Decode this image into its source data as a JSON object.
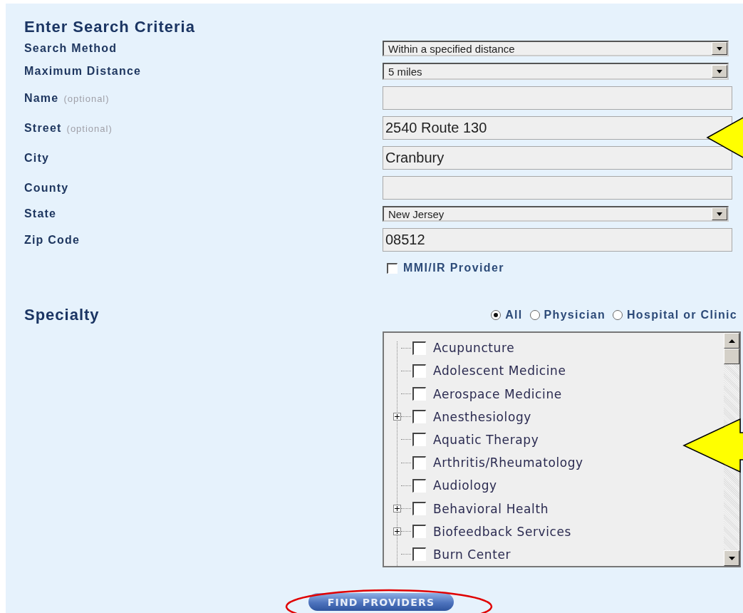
{
  "heading": "Enter Search Criteria",
  "fields": [
    {
      "kind": "select",
      "label": "Search Method",
      "value": "Within a specified distance"
    },
    {
      "kind": "select",
      "label": "Maximum Distance",
      "value": "5 miles"
    },
    {
      "kind": "text",
      "label": "Name",
      "hint": "(optional)"
    },
    {
      "kind": "text",
      "label": "Street",
      "hint": "(optional)",
      "value": "2540 Route 130"
    },
    {
      "kind": "text",
      "label": "City",
      "value": "Cranbury"
    },
    {
      "kind": "text",
      "label": "County"
    },
    {
      "kind": "select",
      "label": "State",
      "value": "New Jersey"
    },
    {
      "kind": "text",
      "label": "Zip Code",
      "value": "08512"
    }
  ],
  "mmi_checkbox": {
    "label": "MMI/IR Provider",
    "checked": false
  },
  "specialty": {
    "title": "Specialty",
    "filters": [
      {
        "label": "All",
        "selected": true
      },
      {
        "label": "Physician",
        "selected": false
      },
      {
        "label": "Hospital or Clinic",
        "selected": false
      }
    ],
    "items": [
      {
        "label": "Acupuncture",
        "expandable": false,
        "checked": false
      },
      {
        "label": "Adolescent Medicine",
        "expandable": false,
        "checked": false
      },
      {
        "label": "Aerospace Medicine",
        "expandable": false,
        "checked": false
      },
      {
        "label": "Anesthesiology",
        "expandable": true,
        "checked": false
      },
      {
        "label": "Aquatic Therapy",
        "expandable": false,
        "checked": false
      },
      {
        "label": "Arthritis/Rheumatology",
        "expandable": false,
        "checked": false
      },
      {
        "label": "Audiology",
        "expandable": false,
        "checked": false
      },
      {
        "label": "Behavioral Health",
        "expandable": true,
        "checked": false
      },
      {
        "label": "Biofeedback Services",
        "expandable": true,
        "checked": false
      },
      {
        "label": "Burn Center",
        "expandable": false,
        "checked": false
      }
    ]
  },
  "button": "FIND PROVIDERS"
}
